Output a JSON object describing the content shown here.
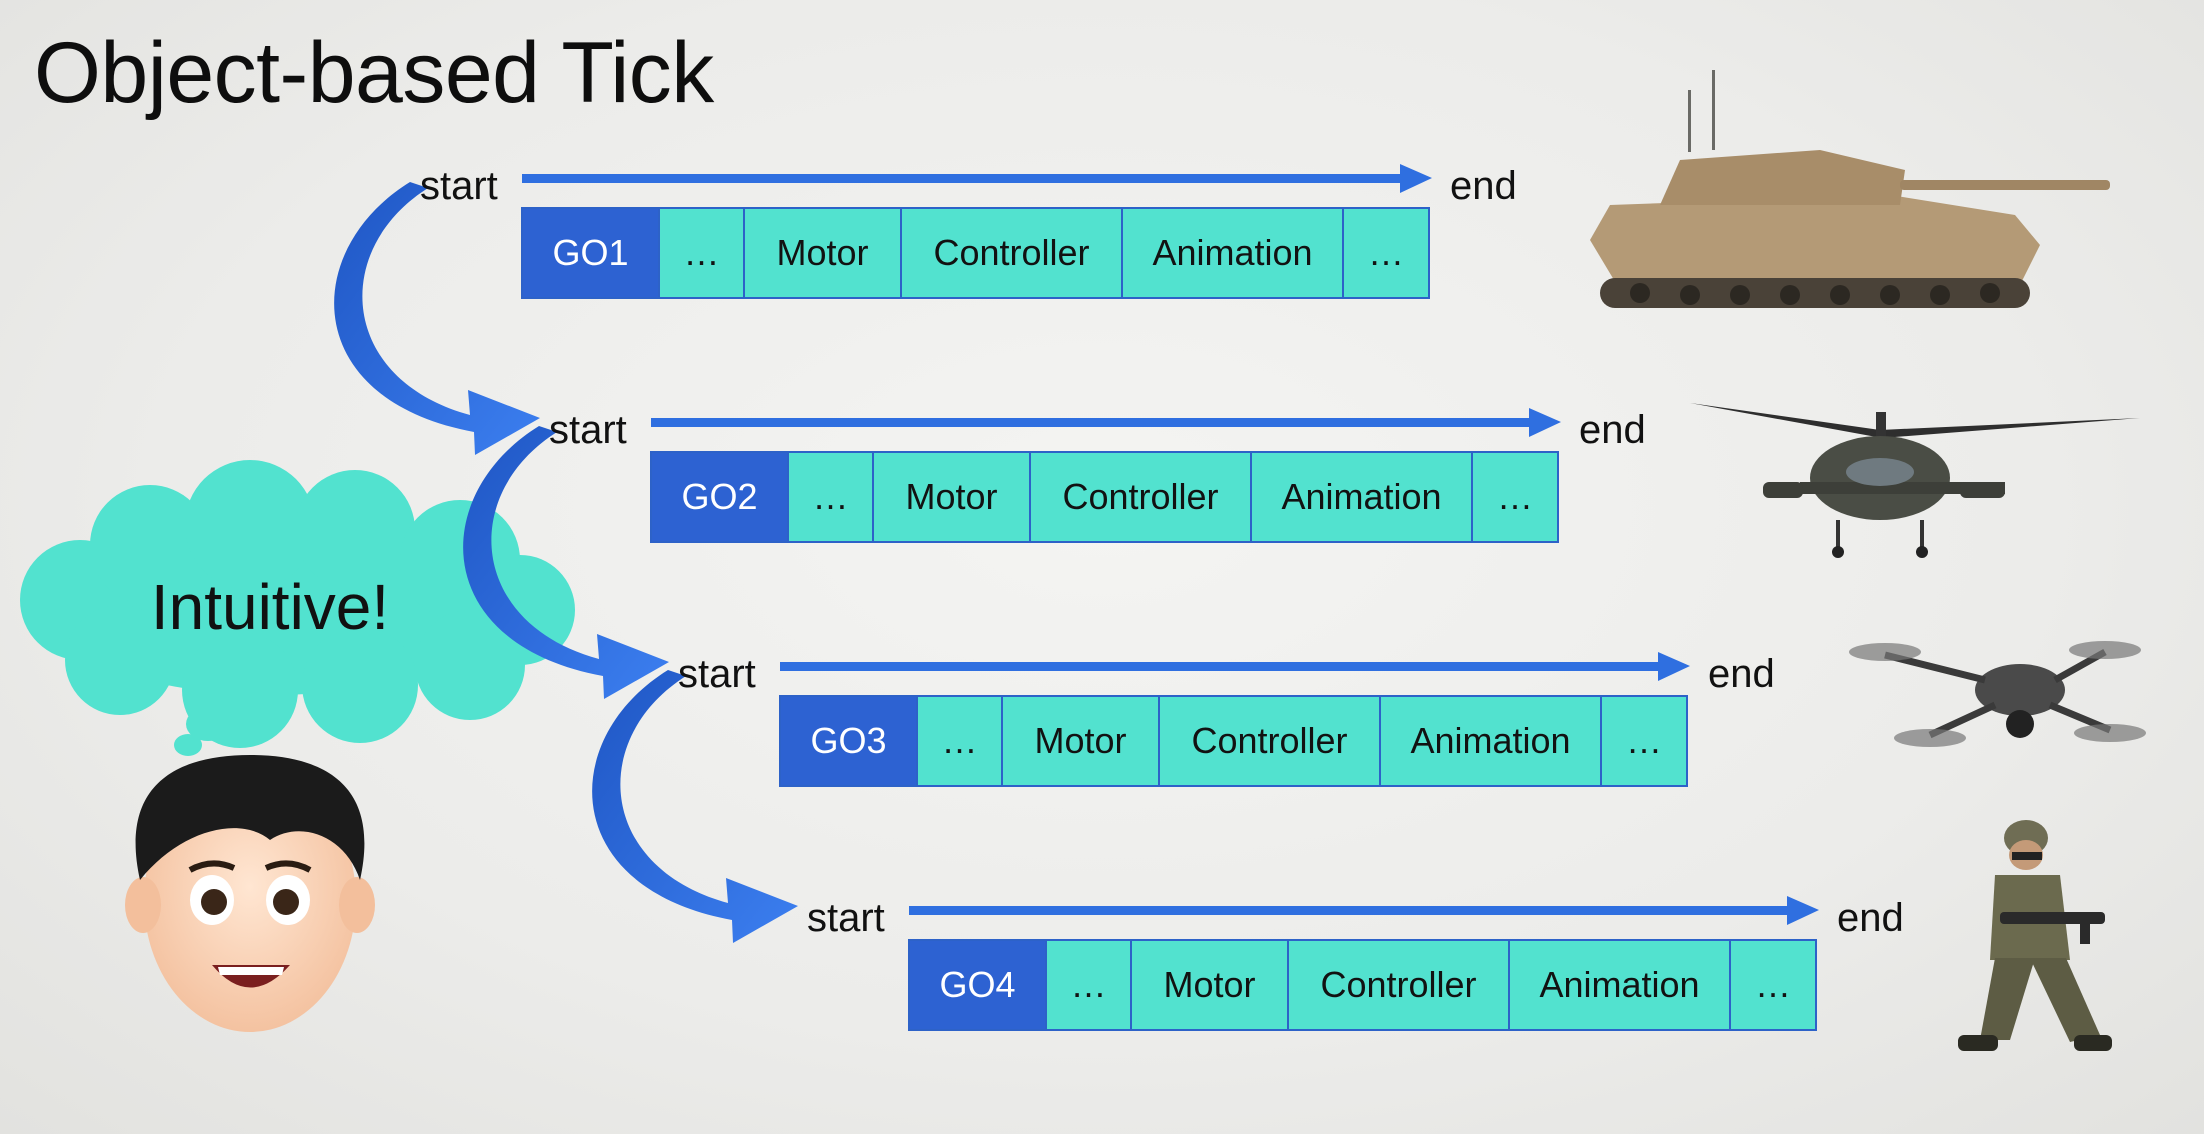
{
  "title": "Object-based Tick",
  "labels": {
    "start": "start",
    "end": "end"
  },
  "rows": [
    {
      "id": "GO1",
      "cells": [
        "GO1",
        "…",
        "Motor",
        "Controller",
        "Animation",
        "…"
      ],
      "icon": "tank-icon"
    },
    {
      "id": "GO2",
      "cells": [
        "GO2",
        "…",
        "Motor",
        "Controller",
        "Animation",
        "…"
      ],
      "icon": "helicopter-icon"
    },
    {
      "id": "GO3",
      "cells": [
        "GO3",
        "…",
        "Motor",
        "Controller",
        "Animation",
        "…"
      ],
      "icon": "drone-icon"
    },
    {
      "id": "GO4",
      "cells": [
        "GO4",
        "…",
        "Motor",
        "Controller",
        "Animation",
        "…"
      ],
      "icon": "soldier-icon"
    }
  ],
  "bubble": {
    "text": "Intuitive!"
  },
  "colors": {
    "go_cell": "#2d62d2",
    "component_cell": "#52e2cf",
    "arrow": "#2f6fe0",
    "bubble": "#52e2cf"
  }
}
